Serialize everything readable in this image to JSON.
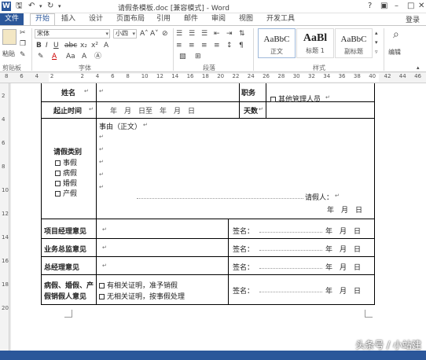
{
  "window": {
    "title": "请假条模板.doc [兼容模式] - Word"
  },
  "tabs": [
    {
      "label": "文件"
    },
    {
      "label": "开始"
    },
    {
      "label": "插入"
    },
    {
      "label": "设计"
    },
    {
      "label": "页面布局"
    },
    {
      "label": "引用"
    },
    {
      "label": "邮件"
    },
    {
      "label": "审阅"
    },
    {
      "label": "视图"
    },
    {
      "label": "开发工具"
    }
  ],
  "account": {
    "login_label": "登录"
  },
  "ribbon": {
    "paste_label": "粘贴",
    "font_name": "宋体",
    "font_size": "小四",
    "groups": {
      "clipboard": "剪贴板",
      "font": "字体",
      "paragraph": "段落",
      "styles": "样式",
      "editing_label": "编辑"
    },
    "styles": [
      {
        "sample": "AaBbC",
        "name": "正文"
      },
      {
        "sample": "AaBl",
        "name": "标题 1"
      },
      {
        "sample": "AaBbC",
        "name": "副标题"
      }
    ]
  },
  "ruler": {
    "numbers": [
      "8",
      "6",
      "4",
      "2",
      "",
      "2",
      "4",
      "6",
      "8",
      "10",
      "12",
      "14",
      "16",
      "18",
      "20",
      "22",
      "24",
      "26",
      "28",
      "30",
      "32",
      "34",
      "36",
      "38",
      "40",
      "42",
      "44",
      "46"
    ]
  },
  "form": {
    "name_label": "姓名",
    "position_label": "职务",
    "other_staff": "其他管理人员",
    "period_label": "起止时间",
    "period_text": "年　月　日至　年　月　日",
    "days_label": "天数",
    "reason_label": "事由（正文）",
    "leave_type_label": "请假类别",
    "leave_types": [
      "事假",
      "病假",
      "婚假",
      "产假"
    ],
    "applicant_label": "请假人：",
    "date_text": "年　月　日",
    "pm_opinion": "项目经理意见",
    "biz_director_opinion": "业务总监意见",
    "gm_opinion": "总经理意见",
    "sick_leave_label_1": "病假、婚假、产",
    "sick_leave_label_2": "假销假人意见",
    "sign_label": "签名：",
    "proof_option_1": "有相关证明，准予销假",
    "proof_option_2": "无相关证明，按事假处理"
  },
  "watermark": "头条号 / 小站建"
}
